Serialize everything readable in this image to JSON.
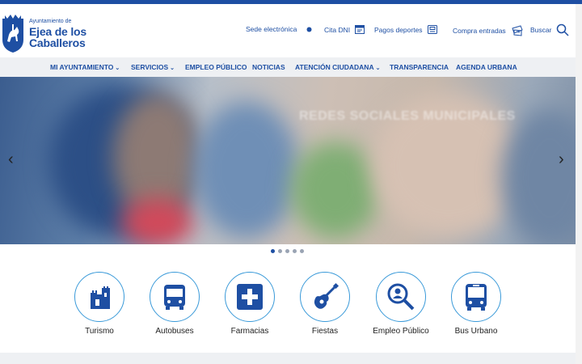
{
  "header": {
    "logo_small": "Ayuntamiento de",
    "logo_line1": "Ejea de los",
    "logo_line2": "Caballeros",
    "links": {
      "sede": "Sede electrónica",
      "cita": "Cita DNI",
      "pagos": "Pagos deportes",
      "compra": "Compra entradas",
      "buscar": "Buscar"
    }
  },
  "nav": {
    "items": [
      "MI AYUNTAMIENTO",
      "SERVICIOS",
      "EMPLEO PÚBLICO",
      "NOTICIAS",
      "ATENCIÓN CIUDADANA",
      "TRANSPARENCIA",
      "AGENDA URBANA"
    ],
    "chevron": "⌄"
  },
  "hero": {
    "text": "REDES SOCIALES MUNICIPALES",
    "prev": "‹",
    "next": "›",
    "active_slide": 1,
    "slide_count": 5
  },
  "quick_access": [
    "Turismo",
    "Autobuses",
    "Farmacias",
    "Fiestas",
    "Empleo Público",
    "Bus Urbano"
  ],
  "colors": {
    "brand": "#1e4fa3",
    "accent": "#3a9ad9",
    "nav_bg": "#eef0f3"
  }
}
